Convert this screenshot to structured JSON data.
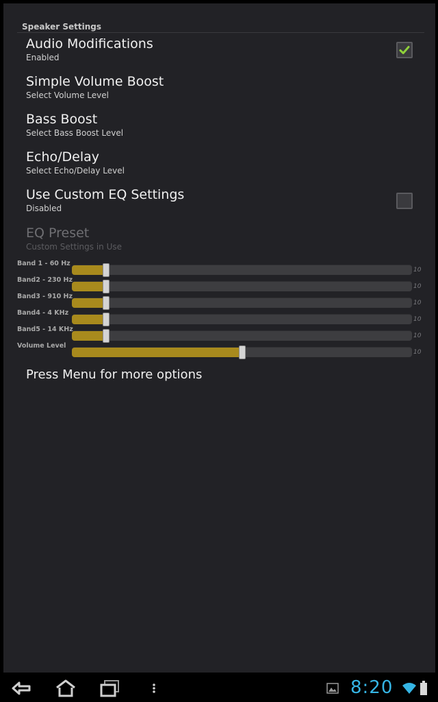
{
  "header": {
    "category": "Speaker Settings"
  },
  "prefs": [
    {
      "title": "Audio Modifications",
      "summary": "Enabled",
      "checked": true
    },
    {
      "title": "Simple Volume Boost",
      "summary": "Select Volume Level"
    },
    {
      "title": "Bass Boost",
      "summary": "Select Bass Boost Level"
    },
    {
      "title": "Echo/Delay",
      "summary": "Select Echo/Delay Level"
    },
    {
      "title": "Use Custom EQ Settings",
      "summary": "Disabled",
      "checked": false
    },
    {
      "title": "EQ Preset",
      "summary": "Custom Settings in Use",
      "enabled": false
    }
  ],
  "sliders": [
    {
      "label": "Band 1 - 60 Hz",
      "value": 1,
      "max": 10,
      "max_label": "10"
    },
    {
      "label": "Band2 - 230 Hz",
      "value": 1,
      "max": 10,
      "max_label": "10"
    },
    {
      "label": "Band3 - 910 Hz",
      "value": 1,
      "max": 10,
      "max_label": "10"
    },
    {
      "label": "Band4 - 4 KHz",
      "value": 1,
      "max": 10,
      "max_label": "10"
    },
    {
      "label": "Band5 - 14 KHz",
      "value": 1,
      "max": 10,
      "max_label": "10"
    },
    {
      "label": "Volume Level",
      "value": 5,
      "max": 10,
      "max_label": "10"
    }
  ],
  "hint": "Press Menu for more options",
  "statusbar": {
    "time": "8:20",
    "icons": [
      "back-icon",
      "home-icon",
      "recent-apps-icon",
      "menu-icon",
      "gallery-notification-icon",
      "wifi-icon",
      "battery-icon"
    ]
  },
  "colors": {
    "accent": "#a88a1d",
    "check": "#8fd13a",
    "clock": "#35b5e5"
  }
}
